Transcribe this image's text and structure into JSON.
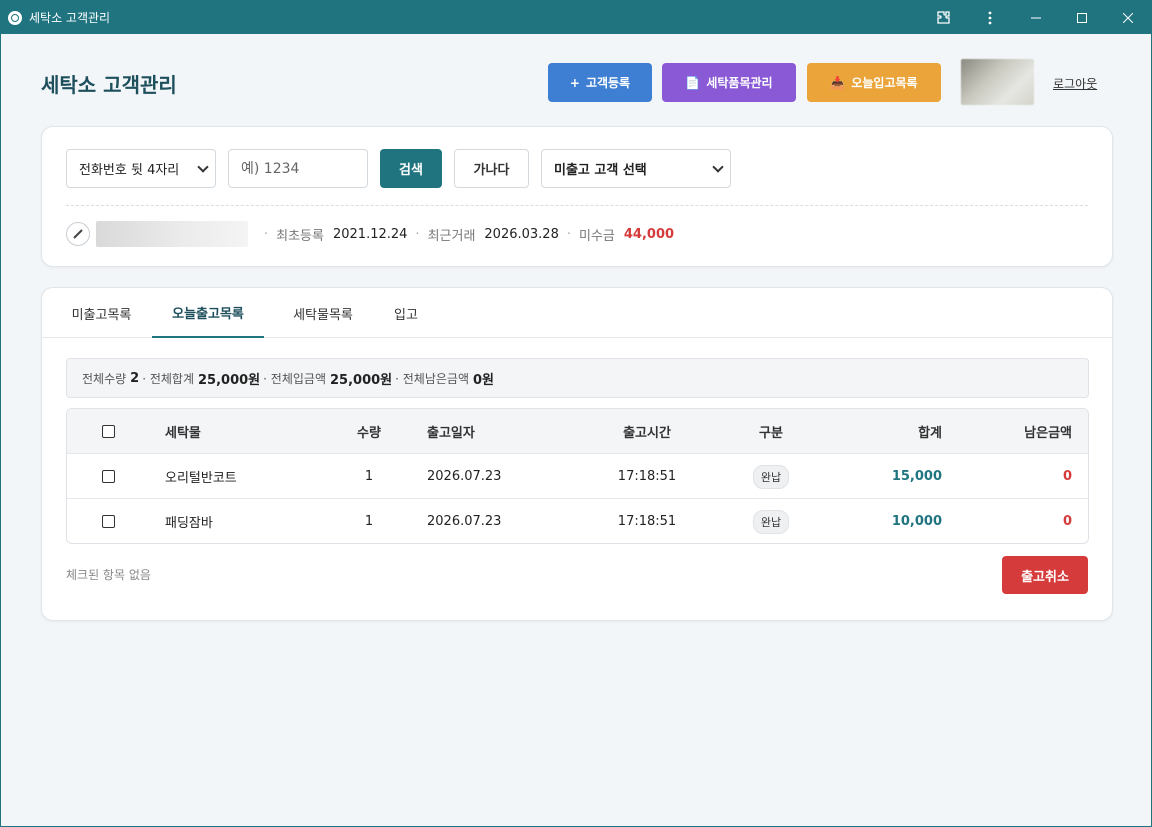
{
  "window": {
    "title": "세탁소 고객관리"
  },
  "header": {
    "app_title": "세탁소 고객관리",
    "register_icon": "+",
    "register_label": "고객등록",
    "items_icon": "📄",
    "items_label": "세탁품목관리",
    "today_icon": "📥",
    "today_label": "오늘입고목록",
    "logout_label": "로그아웃"
  },
  "search": {
    "type_selected": "전화번호 뒷 4자리",
    "input_placeholder": "예) 1234",
    "search_label": "검색",
    "gana_label": "가나다",
    "unreleased_selected": "미출고 고객 선택"
  },
  "customer": {
    "first_reg_label": "최초등록",
    "first_reg_value": "2021.12.24",
    "last_trade_label": "최근거래",
    "last_trade_value": "2026.03.28",
    "unpaid_label": "미수금",
    "unpaid_value": "44,000"
  },
  "tabs": [
    {
      "label": "미출고목록"
    },
    {
      "label": "오늘출고목록"
    },
    {
      "label": "세탁물목록"
    },
    {
      "label": "입고"
    }
  ],
  "summary": {
    "qty_label": "전체수량",
    "qty_value": "2",
    "total_label": "· 전체합계",
    "total_value": "25,000원",
    "paid_label": "· 전체입금액",
    "paid_value": "25,000원",
    "remain_label": "· 전체남은금액",
    "remain_value": "0원"
  },
  "table": {
    "headers": {
      "name": "세탁물",
      "qty": "수량",
      "date": "출고일자",
      "time": "출고시간",
      "type": "구분",
      "sum": "합계",
      "remain": "남은금액"
    },
    "rows": [
      {
        "name": "오리털반코트",
        "qty": "1",
        "date": "2026.07.23",
        "time": "17:18:51",
        "type": "완납",
        "sum": "15,000",
        "remain": "0"
      },
      {
        "name": "패딩잠바",
        "qty": "1",
        "date": "2026.07.23",
        "time": "17:18:51",
        "type": "완납",
        "sum": "10,000",
        "remain": "0"
      }
    ]
  },
  "footer": {
    "checked_status": "체크된 항목 없음",
    "cancel_label": "출고취소"
  }
}
